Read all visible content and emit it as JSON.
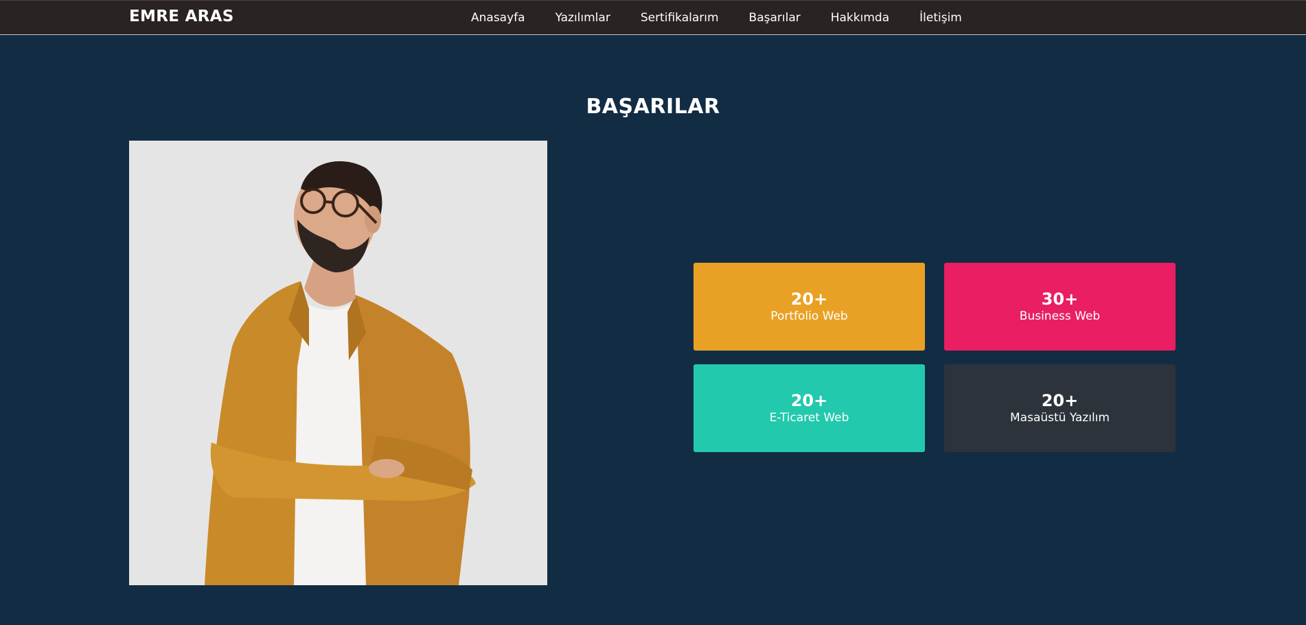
{
  "brand": "EMRE ARAS",
  "nav": [
    "Anasayfa",
    "Yazılımlar",
    "Sertifikalarım",
    "Başarılar",
    "Hakkımda",
    "İletişim"
  ],
  "section_title": "BAŞARILAR",
  "stats": [
    {
      "value": "20+",
      "label": "Portfolio Web",
      "color": "#e9a125"
    },
    {
      "value": "30+",
      "label": "Business Web",
      "color": "#e91e63"
    },
    {
      "value": "20+",
      "label": "E-Ticaret Web",
      "color": "#22c9ad"
    },
    {
      "value": "20+",
      "label": "Masaüstü Yazılım",
      "color": "#2d333b"
    }
  ],
  "colors": {
    "background": "#122c44",
    "navbar": "#2a2323"
  }
}
